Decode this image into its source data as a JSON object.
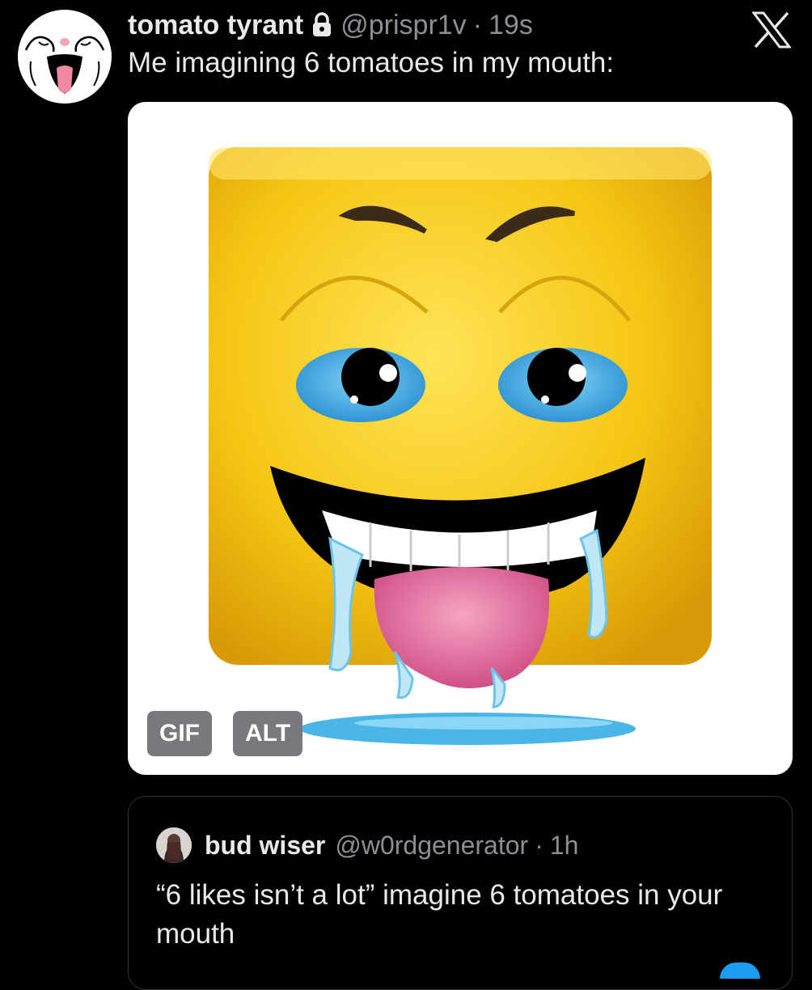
{
  "tweet": {
    "display_name": "tomato tyrant",
    "handle": "@prispr1v",
    "separator": "·",
    "time": "19s",
    "text": "Me imagining 6 tomatoes in my mouth:",
    "avatar_icon": "ahegao-face-icon",
    "lock_icon": "lock-icon",
    "platform_icon": "x-logo-icon",
    "media": {
      "badges": {
        "gif": "GIF",
        "alt": "ALT"
      },
      "image_icon": "drooling-cube-emoji-face"
    }
  },
  "quoted_tweet": {
    "display_name": "bud wiser",
    "handle": "@w0rdgenerator",
    "separator": "·",
    "time": "1h",
    "text": "“6 likes isn’t a lot” imagine 6 tomatoes in your mouth"
  },
  "colors": {
    "background": "#000000",
    "text_primary": "#e7e9ea",
    "text_secondary": "#8b8f94",
    "border": "#2f3336",
    "emoji_yellow": "#f6c615",
    "accent_blue": "#1d9bf0"
  }
}
